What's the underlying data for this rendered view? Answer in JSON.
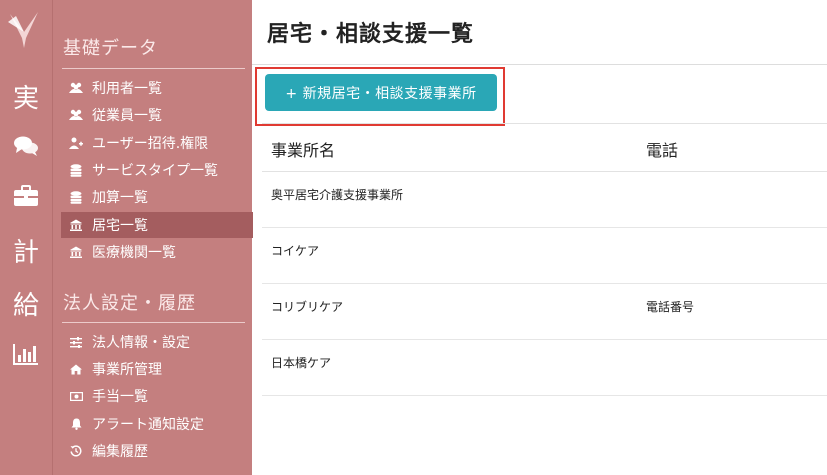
{
  "rail": {
    "items": [
      {
        "name": "rail-jitsu-icon",
        "glyph": "実"
      },
      {
        "name": "chat-icon",
        "glyph": "chat"
      },
      {
        "name": "briefcase-icon",
        "glyph": "briefcase"
      },
      {
        "name": "rail-kei-icon",
        "glyph": "計"
      },
      {
        "name": "rail-kyuu-icon",
        "glyph": "給"
      },
      {
        "name": "bar-chart-icon",
        "glyph": "bar-chart"
      }
    ]
  },
  "sidebar": {
    "section1": "基礎データ",
    "section2": "法人設定・履歴",
    "items": [
      {
        "label": "利用者一覧",
        "icon": "users-icon"
      },
      {
        "label": "従業員一覧",
        "icon": "users-icon"
      },
      {
        "label": "ユーザー招待.権限",
        "icon": "user-plus-icon"
      },
      {
        "label": "サービスタイプ一覧",
        "icon": "database-icon"
      },
      {
        "label": "加算一覧",
        "icon": "database-icon"
      },
      {
        "label": "居宅一覧",
        "icon": "institution-icon",
        "active": true
      },
      {
        "label": "医療機関一覧",
        "icon": "institution-icon"
      },
      {
        "label": "法人情報・設定",
        "icon": "sliders-icon"
      },
      {
        "label": "事業所管理",
        "icon": "home-icon"
      },
      {
        "label": "手当一覧",
        "icon": "money-icon"
      },
      {
        "label": "アラート通知設定",
        "icon": "bell-icon"
      },
      {
        "label": "編集履歴",
        "icon": "history-icon"
      }
    ]
  },
  "main": {
    "title": "居宅・相談支援一覧",
    "new_button": "+ 新規居宅・相談支援事業所",
    "columns": [
      "事業所名",
      "電話"
    ],
    "rows": [
      {
        "name": "奥平居宅介護支援事業所",
        "phone": ""
      },
      {
        "name": "コイケア",
        "phone": ""
      },
      {
        "name": "コリブリケア",
        "phone": "電話番号"
      },
      {
        "name": "日本橋ケア",
        "phone": ""
      }
    ]
  },
  "colors": {
    "sidebar_bg": "#c47f7f",
    "sidebar_active": "#a45d5f",
    "button_bg": "#2aa7b6",
    "highlight_frame": "#e03a32"
  }
}
